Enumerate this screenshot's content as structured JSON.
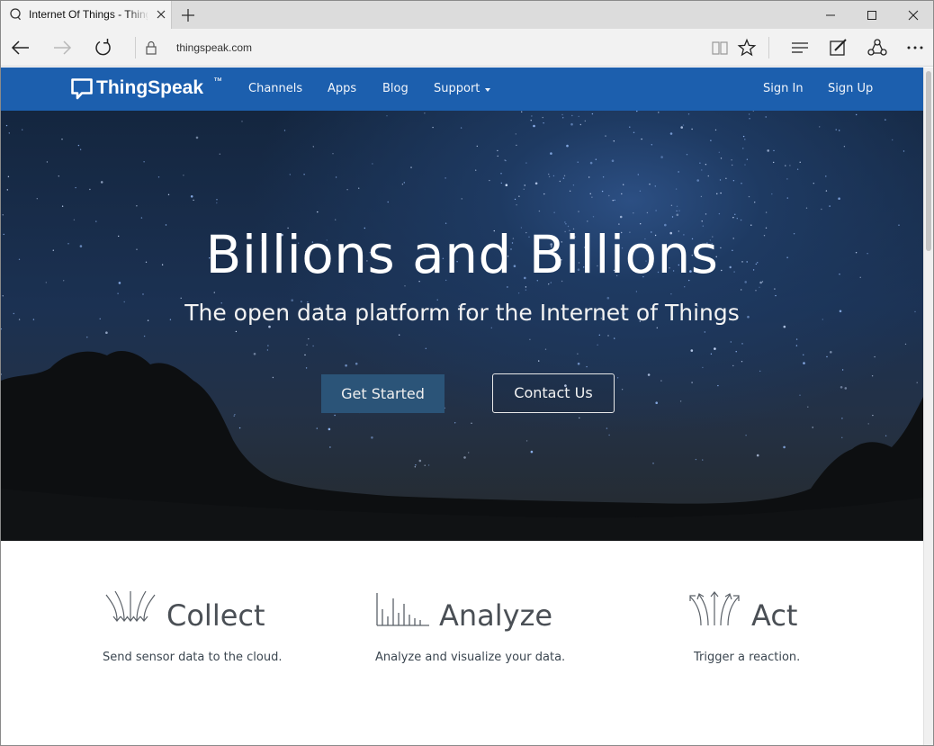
{
  "browser": {
    "tab_title": "Internet Of Things - ThingSpeak",
    "url": "thingspeak.com",
    "icons": [
      "search-icon",
      "close-icon",
      "plus-icon",
      "minimize-icon",
      "maximize-icon",
      "close-window-icon",
      "back-arrow-icon",
      "forward-arrow-icon",
      "refresh-icon",
      "lock-icon",
      "reading-view-icon",
      "star-icon",
      "hub-icon",
      "web-note-icon",
      "share-icon",
      "more-icon"
    ]
  },
  "site_nav": {
    "brand": "ThingSpeak",
    "trademark": "™",
    "links": {
      "channels": "Channels",
      "apps": "Apps",
      "blog": "Blog",
      "support": "Support",
      "sign_in": "Sign In",
      "sign_up": "Sign Up"
    },
    "color": "#1c5fae"
  },
  "hero": {
    "title": "Billions and Billions",
    "subtitle": "The open data platform for the Internet of Things",
    "primary_button": "Get Started",
    "secondary_button": "Contact Us",
    "primary_button_color": "#2b5478"
  },
  "features": [
    {
      "title": "Collect",
      "description": "Send sensor data to the cloud.",
      "icon": "collect-arrows-icon"
    },
    {
      "title": "Analyze",
      "description": "Analyze and visualize your data.",
      "icon": "analyze-bars-icon"
    },
    {
      "title": "Act",
      "description": "Trigger a reaction.",
      "icon": "act-arrows-icon"
    }
  ]
}
